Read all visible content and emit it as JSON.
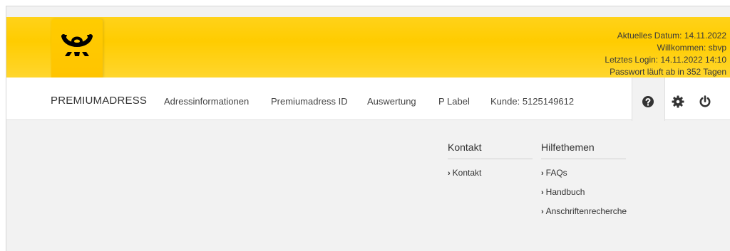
{
  "header": {
    "logo_icon": "post-horn-icon",
    "user_info": {
      "date_line": "Aktuelles Datum: 14.11.2022",
      "welcome_line": "Willkommen: sbvp",
      "last_login_line": "Letztes Login: 14.11.2022 14:10",
      "password_line": "Passwort läuft ab in 352 Tagen"
    }
  },
  "nav": {
    "brand": "PREMIUMADRESS",
    "links": [
      "Adressinformationen",
      "Premiumadress ID",
      "Auswertung",
      "P Label",
      "Kunde: 5125149612"
    ],
    "icons": [
      "help-icon",
      "gear-icon",
      "power-icon"
    ]
  },
  "help_menu": {
    "kontakt": {
      "title": "Kontakt",
      "items": [
        "Kontakt"
      ]
    },
    "hilfethemen": {
      "title": "Hilfethemen",
      "items": [
        "FAQs",
        "Handbuch",
        "Anschriftenrecherche"
      ]
    }
  },
  "colors": {
    "brand_yellow": "#ffcc00",
    "text": "#333333",
    "background": "#f2f2f2"
  }
}
